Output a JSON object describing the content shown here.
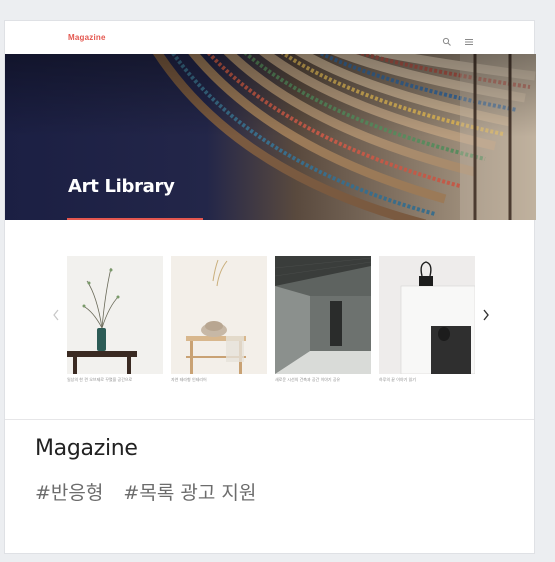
{
  "header": {
    "logo": "Magazine",
    "logo_color": "#e4574f"
  },
  "icons": {
    "search": "search-icon",
    "menu": "hamburger-menu-icon",
    "prev": "chevron-left-icon",
    "next": "chevron-right-icon"
  },
  "hero": {
    "title": "Art Library",
    "accent_color": "#e4574f"
  },
  "gallery": {
    "items": [
      {
        "image": "vase-with-branches-on-table",
        "caption": "일상의 한 켠 오브제로 꾸몄을 공간으로"
      },
      {
        "image": "flowers-on-wooden-stool",
        "caption": "자연 테라형 인테리어"
      },
      {
        "image": "concrete-interior-room",
        "caption": "새로운 시선의 건축과 공간 이야기 공유"
      },
      {
        "image": "open-book-with-binder-clip",
        "caption": "하루의 끝 이야기 읽기"
      }
    ]
  },
  "footer": {
    "title": "Magazine",
    "tags": [
      "#반응형",
      "#목록 광고 지원"
    ]
  }
}
